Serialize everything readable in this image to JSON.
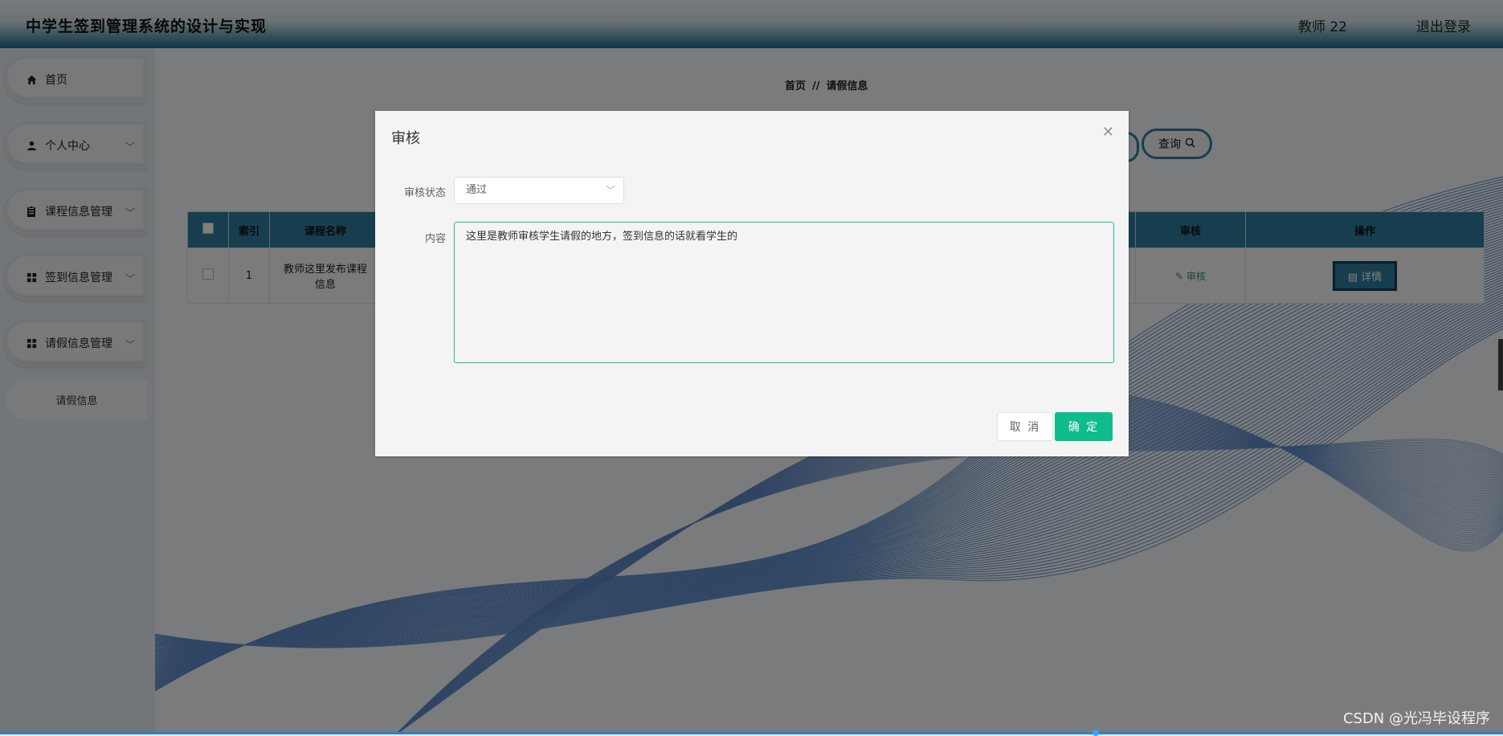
{
  "header": {
    "title": "中学生签到管理系统的设计与实现",
    "user": "教师 22",
    "logout": "退出登录"
  },
  "sidebar": {
    "items": [
      {
        "label": "首页",
        "icon": "home-icon"
      },
      {
        "label": "个人中心",
        "icon": "user-icon"
      },
      {
        "label": "课程信息管理",
        "icon": "clipboard-icon"
      },
      {
        "label": "签到信息管理",
        "icon": "grid-icon"
      },
      {
        "label": "请假信息管理",
        "icon": "grid-icon"
      }
    ],
    "sub_item": "请假信息"
  },
  "breadcrumb": {
    "home": "首页",
    "separator": "//",
    "current": "请假信息"
  },
  "toolbar": {
    "query": "查询"
  },
  "table": {
    "headers": {
      "index": "索引",
      "course": "课程名称",
      "audit": "审核",
      "action": "操作"
    },
    "rows": [
      {
        "index": "1",
        "course": "教师这里发布课程信息",
        "audit": "审核",
        "detail": "详情"
      }
    ]
  },
  "dialog": {
    "title": "审核",
    "status_label": "审核状态",
    "status_value": "通过",
    "content_label": "内容",
    "content_value": "这里是教师审核学生请假的地方，签到信息的话就看学生的",
    "cancel": "取 消",
    "confirm": "确 定"
  },
  "watermark": "CSDN @光冯毕设程序",
  "colors": {
    "accent": "#2f7d9c",
    "confirm": "#0fbc8c",
    "header_dark": "#1f6a8c"
  }
}
